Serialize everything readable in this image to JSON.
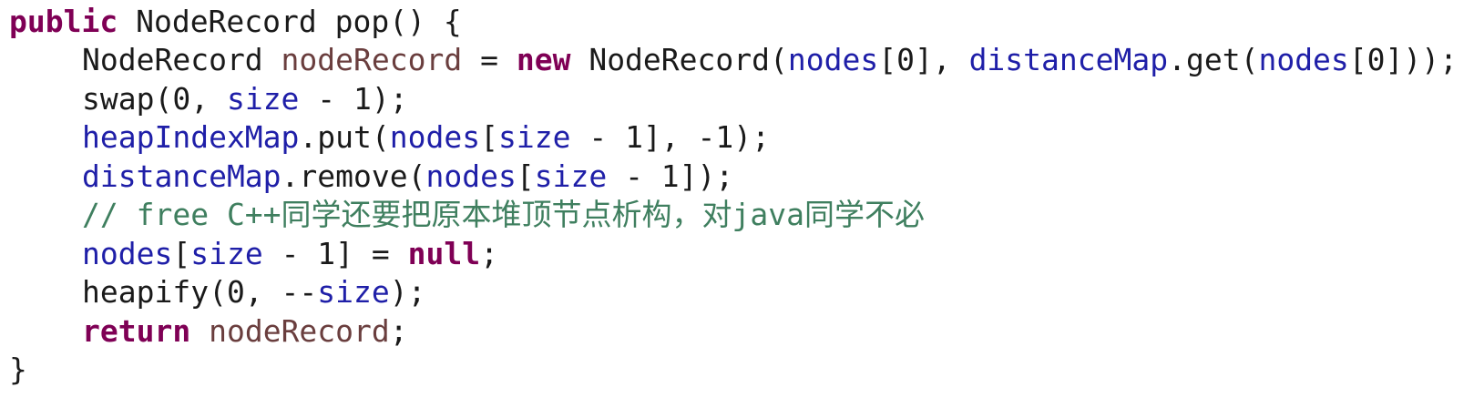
{
  "code": {
    "lines": [
      {
        "tokens": [
          "public",
          " NodeRecord pop() {"
        ]
      },
      {
        "tokens": [
          "NodeRecord ",
          "nodeRecord",
          " = ",
          "new",
          " NodeRecord(",
          "nodes",
          "[0], ",
          "distanceMap",
          ".get(",
          "nodes",
          "[0]));"
        ]
      },
      {
        "tokens": [
          "swap(0, ",
          "size",
          " - 1);"
        ]
      },
      {
        "tokens": [
          "heapIndexMap",
          ".put(",
          "nodes",
          "[",
          "size",
          " - 1], -1);"
        ]
      },
      {
        "tokens": [
          "distanceMap",
          ".remove(",
          "nodes",
          "[",
          "size",
          " - 1]);"
        ]
      },
      {
        "tokens": [
          "// free C++同学还要把原本堆顶节点析构，对java同学不必"
        ]
      },
      {
        "tokens": [
          "nodes",
          "[",
          "size",
          " - 1] = ",
          "null",
          ";"
        ]
      },
      {
        "tokens": [
          "heapify(0, --",
          "size",
          ");"
        ]
      },
      {
        "tokens": [
          "return",
          " ",
          "nodeRecord",
          ";"
        ]
      },
      {
        "tokens": [
          "}"
        ]
      }
    ]
  },
  "syntax_colors": {
    "keyword": "#7f0055",
    "field": "#1f1fa8",
    "local_variable": "#6a3e3e",
    "comment": "#3f7f5f",
    "text": "#1a1a1a",
    "background": "#ffffff"
  }
}
